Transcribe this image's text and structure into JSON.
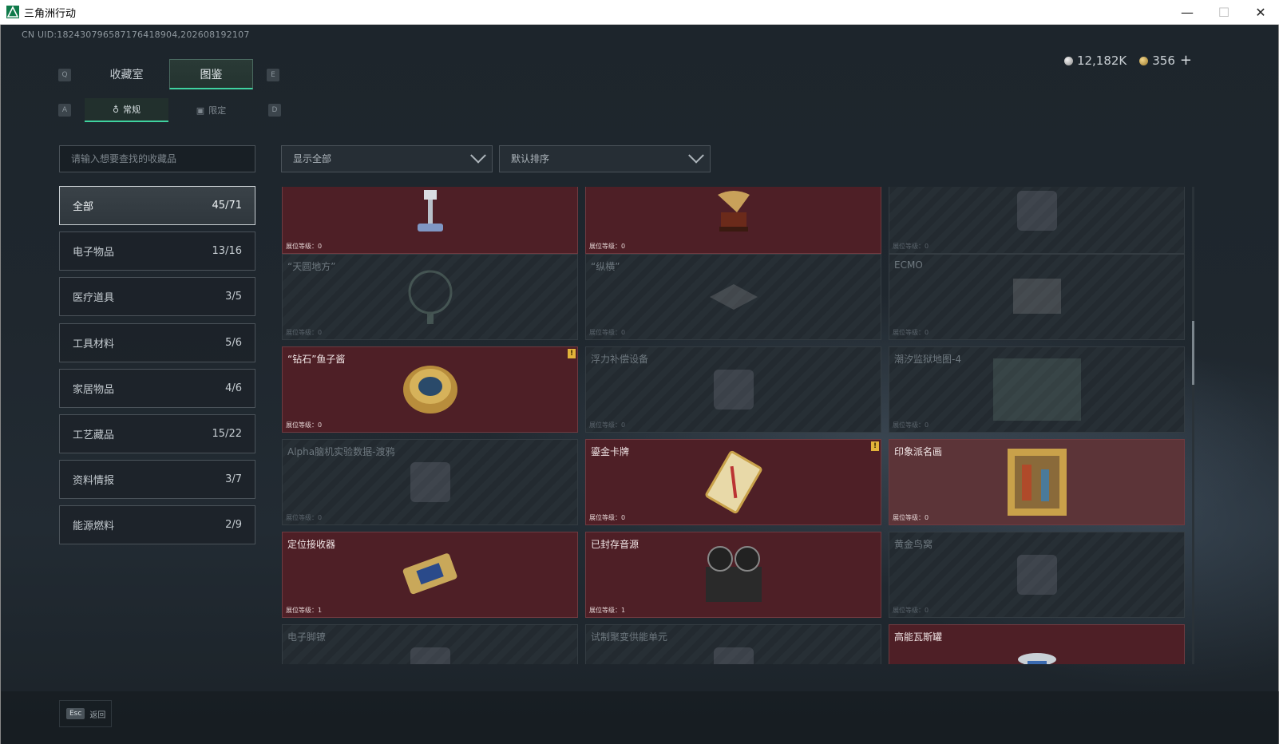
{
  "window": {
    "title": "三角洲行动",
    "minimize": "—",
    "maximize": "☐",
    "close": "✕"
  },
  "uid": "CN UID:182430796587176418904,202608192107",
  "currency": {
    "silver": "12,182K",
    "gold": "356",
    "add": "+"
  },
  "keys": {
    "q": "Q",
    "e": "E",
    "a": "A",
    "d": "D"
  },
  "tabs": {
    "collection_room": "收藏室",
    "catalog": "图鉴"
  },
  "subtabs": {
    "regular": "常规",
    "limited": "限定"
  },
  "search": {
    "placeholder": "请输入想要查找的收藏品"
  },
  "filters": {
    "show": "显示全部",
    "sort": "默认排序"
  },
  "categories": [
    {
      "label": "全部",
      "count": "45/71"
    },
    {
      "label": "电子物品",
      "count": "13/16"
    },
    {
      "label": "医疗道具",
      "count": "3/5"
    },
    {
      "label": "工具材料",
      "count": "5/6"
    },
    {
      "label": "家居物品",
      "count": "4/6"
    },
    {
      "label": "工艺藏品",
      "count": "15/22"
    },
    {
      "label": "资料情报",
      "count": "3/7"
    },
    {
      "label": "能源燃料",
      "count": "2/9"
    }
  ],
  "level_label_prefix": "展位等级：",
  "items": [
    {
      "name": "",
      "level": "展位等级：0",
      "owned": true,
      "icon": "robot-arm-icon"
    },
    {
      "name": "",
      "level": "展位等级：0",
      "owned": true,
      "icon": "gramophone-icon"
    },
    {
      "name": "",
      "level": "展位等级：0",
      "owned": false,
      "icon": "bowl-icon"
    },
    {
      "name": "“天圆地方”",
      "level": "展位等级：0",
      "owned": false,
      "icon": "globe-icon"
    },
    {
      "name": "“纵横”",
      "level": "展位等级：0",
      "owned": false,
      "icon": "chessboard-icon"
    },
    {
      "name": "ECMO",
      "level": "展位等级：0",
      "owned": false,
      "icon": "machine-icon"
    },
    {
      "name": "“钻石”鱼子酱",
      "level": "展位等级：0",
      "owned": true,
      "icon": "caviar-tin-icon",
      "badge": "!"
    },
    {
      "name": "浮力补偿设备",
      "level": "展位等级：0",
      "owned": false,
      "icon": "vest-icon"
    },
    {
      "name": "潮汐监狱地图-4",
      "level": "展位等级：0",
      "owned": false,
      "icon": "map-icon"
    },
    {
      "name": "Alpha脑机实验数据-渡鸦",
      "level": "展位等级：0",
      "owned": false,
      "icon": "device-icon"
    },
    {
      "name": "鎏金卡牌",
      "level": "展位等级：0",
      "owned": true,
      "icon": "gold-card-icon",
      "badge": "!"
    },
    {
      "name": "印象派名画",
      "level": "展位等级：0",
      "owned": true,
      "light": true,
      "icon": "painting-icon"
    },
    {
      "name": "定位接收器",
      "level": "展位等级：1",
      "owned": true,
      "icon": "receiver-icon"
    },
    {
      "name": "已封存音源",
      "level": "展位等级：1",
      "owned": true,
      "icon": "tape-reel-icon"
    },
    {
      "name": "黄金鸟窝",
      "level": "展位等级：0",
      "owned": false,
      "icon": "nest-icon"
    },
    {
      "name": "电子脚镣",
      "level": "",
      "owned": false,
      "icon": "anklet-icon"
    },
    {
      "name": "试制聚变供能单元",
      "level": "",
      "owned": false,
      "icon": "power-unit-icon"
    },
    {
      "name": "高能瓦斯罐",
      "level": "",
      "owned": true,
      "icon": "gas-can-icon"
    }
  ],
  "footer": {
    "esc_key": "Esc",
    "esc_label": "返回"
  }
}
